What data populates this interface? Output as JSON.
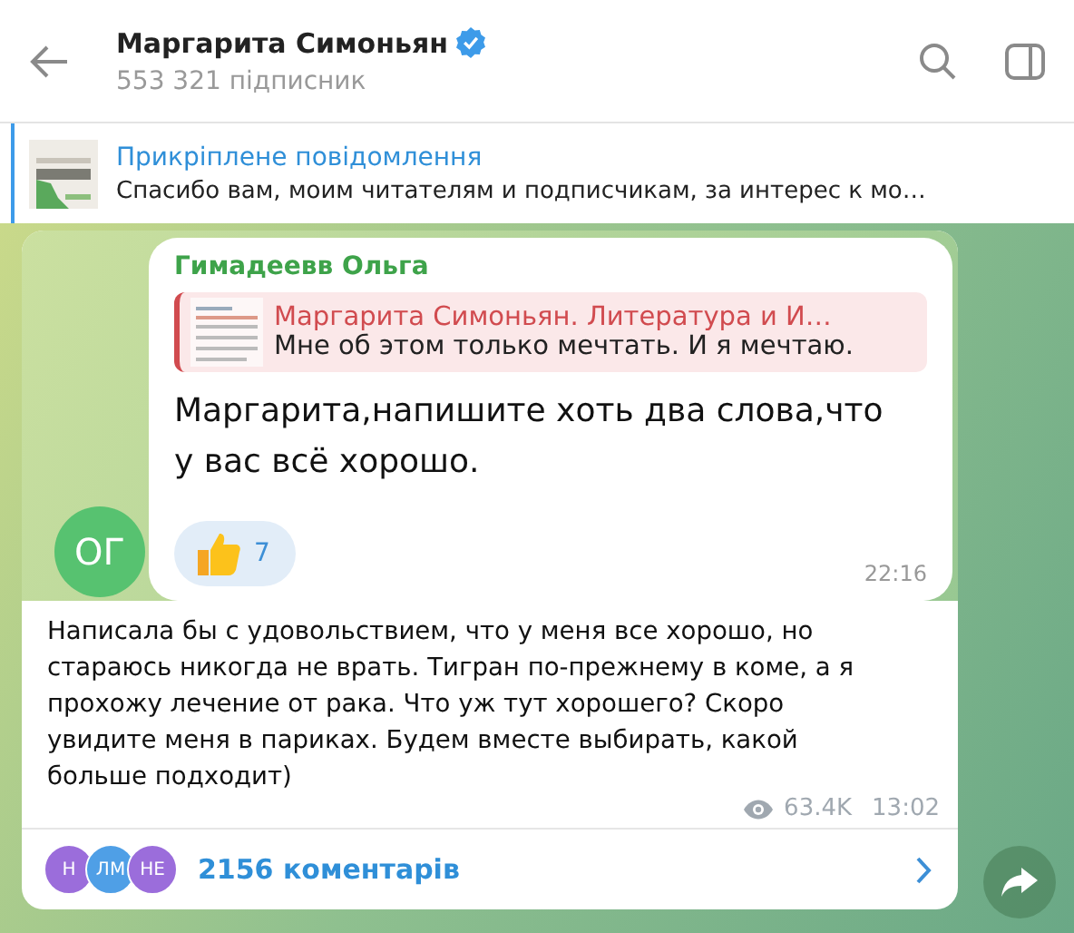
{
  "header": {
    "title": "Маргарита Симоньян",
    "verified": true,
    "subtitle": "553 321 підписник"
  },
  "pinned": {
    "label": "Прикріплене повідомлення",
    "text": "Спасибо вам, моим читателям и подписчикам, за интерес к мо…"
  },
  "post": {
    "screenshot": {
      "avatar": "ОГ",
      "sender": "Гимадеевв Ольга",
      "reply": {
        "title": "Маргарита Симоньян. Литература и И…",
        "text": "Мне об этом только мечтать. И я мечтаю."
      },
      "text": "Маргарита,напишите хоть два слова,что у вас всё хорошо.",
      "reactions": [
        {
          "count": "7"
        }
      ],
      "time": "22:16"
    },
    "text": "Написала бы с удовольствием, что у меня все хорошо, но стараюсь никогда не врать. Тигран по-прежнему в коме, а я прохожу лечение от рака. Что уж тут хорошего? Скоро увидите меня в париках. Будем вместе выбирать, какой больше подходит)",
    "views": "63.4K",
    "time": "13:02",
    "comments": {
      "avatars": [
        {
          "initials": "Н",
          "color": "#9b6ddb"
        },
        {
          "initials": "ЛМ",
          "color": "#4f9fe6"
        },
        {
          "initials": "НЕ",
          "color": "#9b6ddb"
        }
      ],
      "label": "2156 коментарів"
    }
  }
}
